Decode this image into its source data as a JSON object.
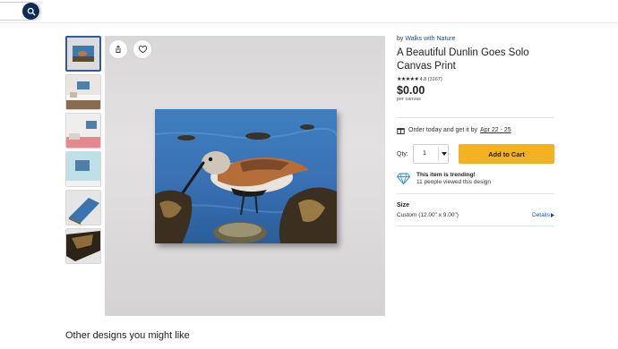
{
  "header": {
    "search_icon": "magnifier-icon"
  },
  "gallery": {
    "thumbnail_count": 6,
    "selected_index": 0
  },
  "product": {
    "seller_prefix": "by",
    "seller_name": "Walks with Nature",
    "title": "A Beautiful Dunlin Goes Solo Canvas Print",
    "stars": "★★★★★",
    "rating": "4.8 (3167)",
    "price": "$0.00",
    "price_unit": "per canvas"
  },
  "delivery": {
    "text": "Order today and get it by",
    "date": "Apr 22 - 25"
  },
  "purchase": {
    "qty_label": "Qty:",
    "qty_value": "1",
    "add_to_cart": "Add to Cart"
  },
  "trending": {
    "title": "This item is trending!",
    "subtitle": "11 people viewed this design"
  },
  "size": {
    "label": "Size",
    "value": "Custom (12.00\" x 9.00\")",
    "details": "Details"
  },
  "footer": {
    "title": "Other designs you might like"
  },
  "colors": {
    "accent": "#f4b122",
    "link": "#1a4d99",
    "navy": "#0e2a57"
  }
}
